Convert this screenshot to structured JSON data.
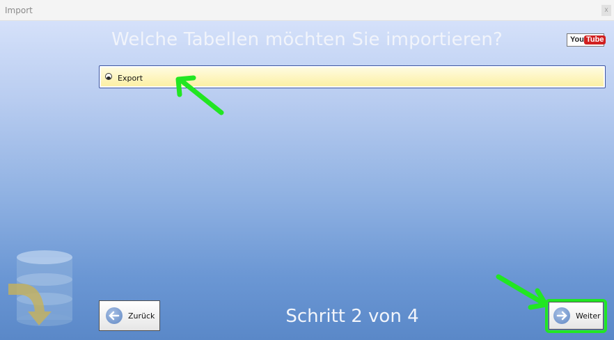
{
  "window": {
    "title": "Import",
    "close_symbol": "x"
  },
  "main": {
    "heading": "Welche Tabellen möchten Sie importieren?",
    "youtube": {
      "you": "You",
      "tube": "Tube"
    },
    "tables": [
      {
        "label": "Export",
        "icon": "half-filled-circle-icon"
      }
    ],
    "step_text": "Schritt 2 von 4"
  },
  "buttons": {
    "back_label": "Zurück",
    "next_label": "Weiter"
  },
  "colors": {
    "annotation_green": "#22e622",
    "selected_row": "#fcf0a4",
    "list_border": "#3e56a2"
  }
}
